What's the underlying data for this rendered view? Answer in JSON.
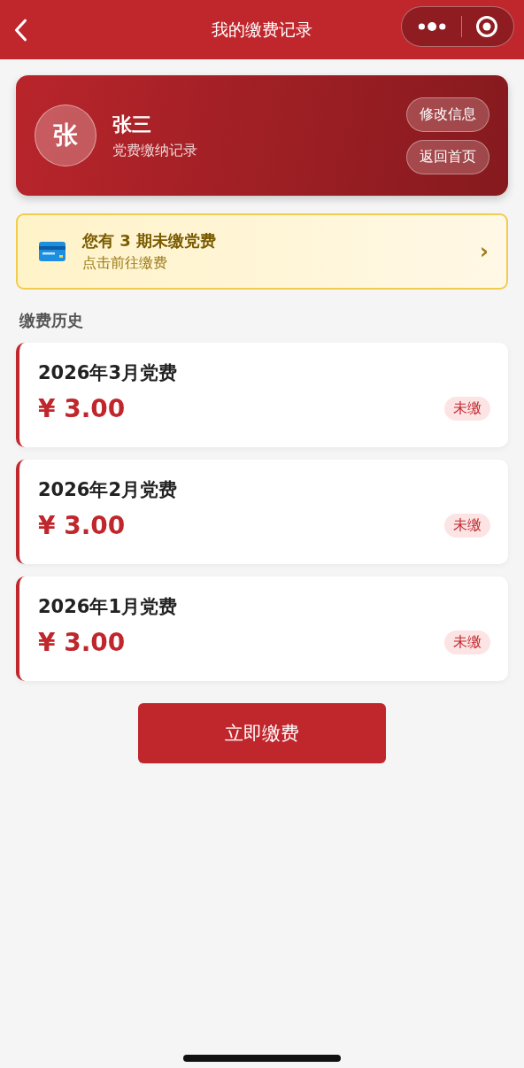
{
  "nav": {
    "title": "我的缴费记录"
  },
  "profile": {
    "avatar": "张",
    "name": "张三",
    "subtitle": "党费缴纳记录",
    "buttons": [
      "修改信息",
      "返回首页"
    ]
  },
  "notice": {
    "title_parts": [
      "您有",
      "3",
      "期未缴党费"
    ],
    "subtitle": "点击前往缴费",
    "arrow": "›"
  },
  "section_title": "缴费历史",
  "records": [
    {
      "title": "2026年3月党费",
      "amount": "¥ 3.00",
      "status": "未缴"
    },
    {
      "title": "2026年2月党费",
      "amount": "¥ 3.00",
      "status": "未缴"
    },
    {
      "title": "2026年1月党费",
      "amount": "¥ 3.00",
      "status": "未缴"
    }
  ],
  "pay_button": "立即缴费"
}
